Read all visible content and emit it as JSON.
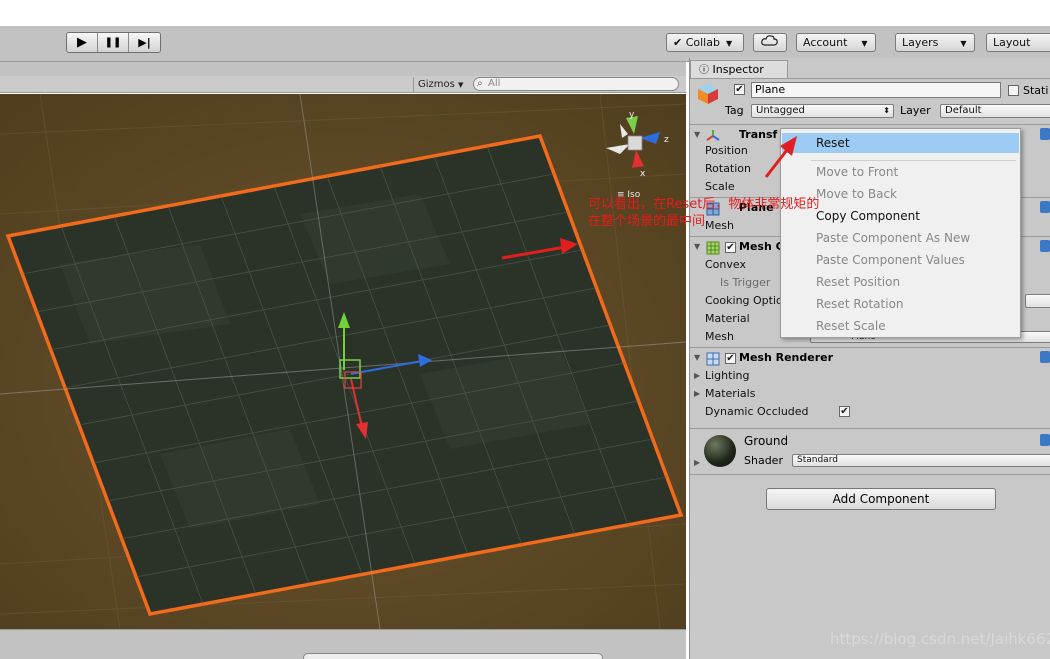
{
  "toolbar": {
    "play_icon": "▶",
    "pause_icon": "❚❚",
    "step_icon": "▶|",
    "collab_label": "Collab",
    "cloud_icon": "cloud-icon",
    "account_label": "Account",
    "layers_label": "Layers",
    "layout_label": "Layout"
  },
  "scene": {
    "gizmos_label": "Gizmos",
    "search_placeholder": "All",
    "persp_label": "≡ Iso",
    "axis_x": "x",
    "axis_y": "y",
    "axis_z": "z",
    "plane_color": "#2b3329",
    "outline_color": "#f26a1b",
    "background_color": "#5b4724"
  },
  "inspector": {
    "tab_label": "Inspector",
    "object_name": "Plane",
    "static_label": "Stati",
    "tag_label": "Tag",
    "tag_value": "Untagged",
    "layer_label": "Layer",
    "layer_value": "Default",
    "transform": {
      "title": "Transf",
      "position_label": "Position",
      "rotation_label": "Rotation",
      "scale_label": "Scale"
    },
    "plane_filter": {
      "title": "Plane",
      "mesh_label": "Mesh"
    },
    "mesh_collider": {
      "title": "Mesh C",
      "convex_label": "Convex",
      "is_trigger_label": "Is Trigger",
      "cooking_label": "Cooking Optio",
      "material_label": "Material",
      "mesh_label": "Mesh",
      "mesh_value": "Plane"
    },
    "mesh_renderer": {
      "title": "Mesh Renderer",
      "lighting_label": "Lighting",
      "materials_label": "Materials",
      "dynamic_occluded_label": "Dynamic Occluded",
      "dynamic_occluded_checked": "✔"
    },
    "material": {
      "name": "Ground",
      "shader_label": "Shader",
      "shader_value": "Standard"
    },
    "add_component_label": "Add Component"
  },
  "context_menu": {
    "items": [
      {
        "label": "Reset",
        "enabled": true,
        "highlighted": true
      },
      {
        "label": "Move to Front",
        "enabled": false
      },
      {
        "label": "Move to Back",
        "enabled": false
      },
      {
        "label": "Copy Component",
        "enabled": true
      },
      {
        "label": "Paste Component As New",
        "enabled": false
      },
      {
        "label": "Paste Component Values",
        "enabled": false
      },
      {
        "label": "Reset Position",
        "enabled": false
      },
      {
        "label": "Reset Rotation",
        "enabled": false
      },
      {
        "label": "Reset Scale",
        "enabled": false
      }
    ]
  },
  "annotation": {
    "line1": "可以看出，在Reset后，物体非常规矩的",
    "line2": "在整个场景的最中间",
    "color": "#e61b1b"
  },
  "watermark": "https://blog.csdn.net/Jaihk662"
}
